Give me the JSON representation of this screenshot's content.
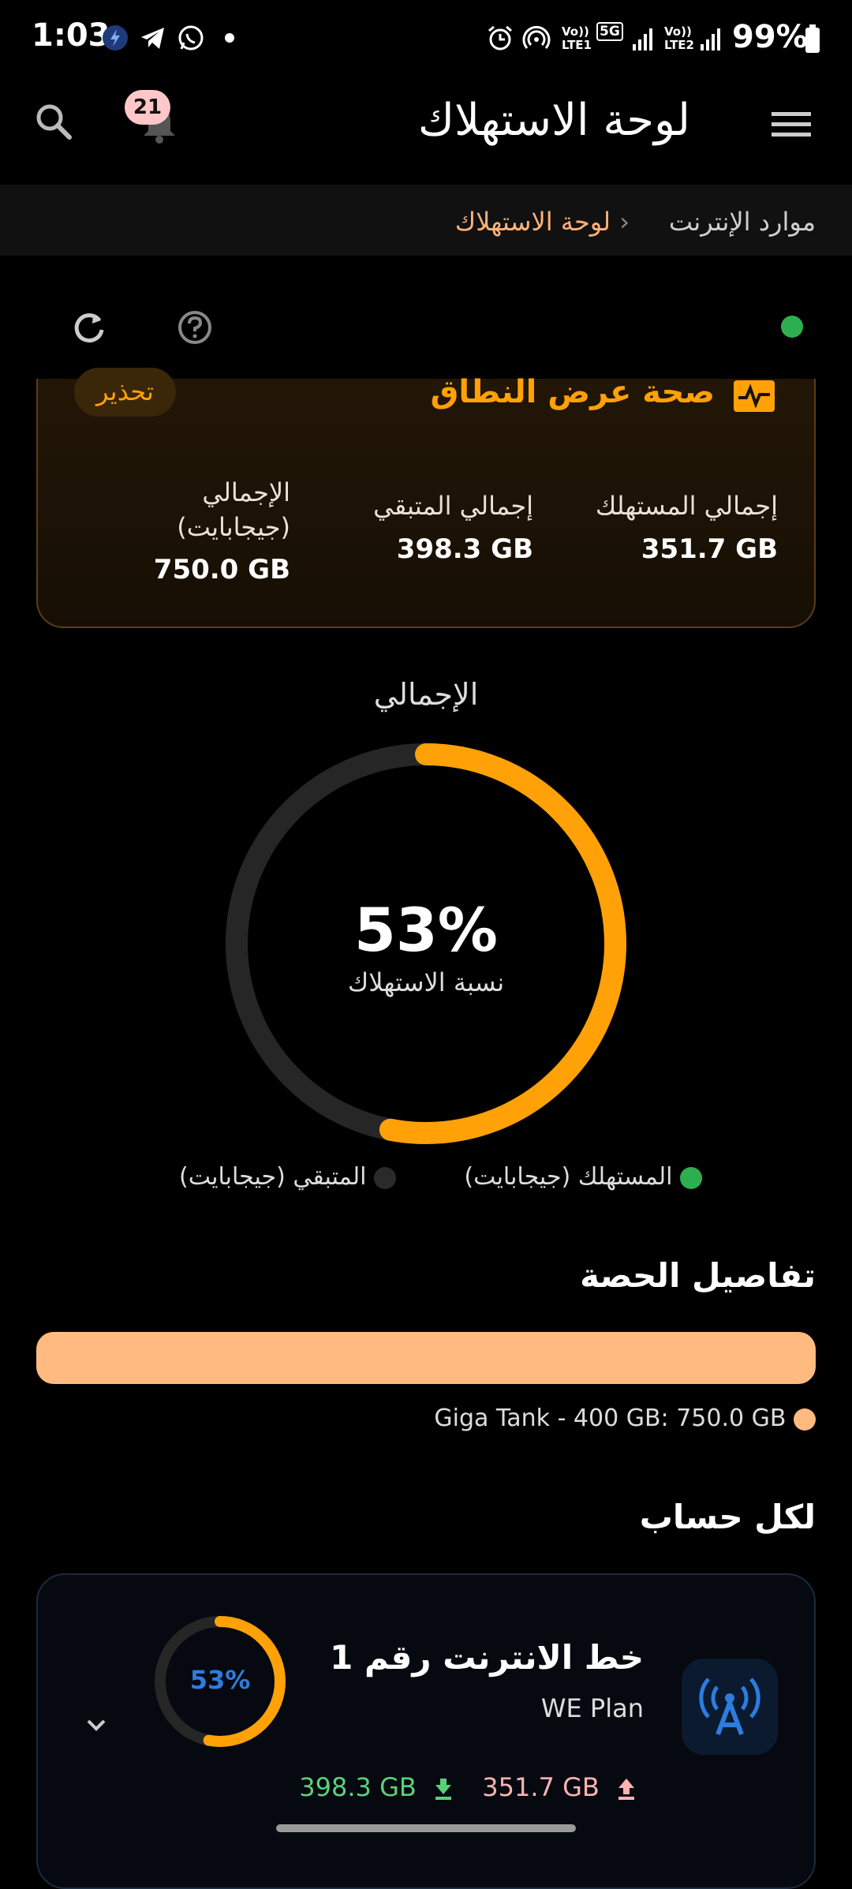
{
  "status_bar": {
    "time": "1:03",
    "battery": "99%",
    "net_label_1": "LTE1",
    "net_label_2": "LTE2",
    "net_5g": "5G",
    "vo_label": "Vo))"
  },
  "header": {
    "title": "لوحة الاستهلاك",
    "notification_count": "21"
  },
  "breadcrumb": {
    "parent": "موارد الإنترنت",
    "separator": "›",
    "current": "لوحة الاستهلاك"
  },
  "health_card": {
    "title": "صحة عرض النطاق",
    "badge": "تحذير",
    "stats": [
      {
        "label": "إجمالي المستهلك",
        "value": "351.7 GB"
      },
      {
        "label": "إجمالي المتبقي",
        "value": "398.3 GB"
      },
      {
        "label_line1": "الإجمالي",
        "label_line2": "(جيجابايت)",
        "value": "750.0 GB"
      }
    ]
  },
  "gauge": {
    "title": "الإجمالي",
    "percent_text": "53%",
    "percent_value": 0.53,
    "subtitle": "نسبة الاستهلاك",
    "legend": [
      {
        "label": "المستهلك (جيجابايت)",
        "color": "#2eaf4f"
      },
      {
        "label": "المتبقي (جيجابايت)",
        "color": "#2a2a2a"
      }
    ]
  },
  "quota": {
    "section_title": "تفاصيل الحصة",
    "bar_color": "#ffba80",
    "legend_label": "Giga Tank - 400 GB: 750.0 GB"
  },
  "per_account": {
    "section_title": "لكل حساب",
    "account": {
      "name": "خط الانترنت رقم 1",
      "plan": "WE Plan",
      "percent_text": "53%",
      "percent_value": 0.53,
      "remaining": "398.3 GB",
      "used": "351.7 GB"
    }
  },
  "colors": {
    "accent": "#ffa107",
    "ring_track": "#262626",
    "green": "#2eaf4f",
    "used_pink": "#ffb3b3",
    "download_green": "#5bd07a",
    "badge_bg": "#3a2608"
  }
}
